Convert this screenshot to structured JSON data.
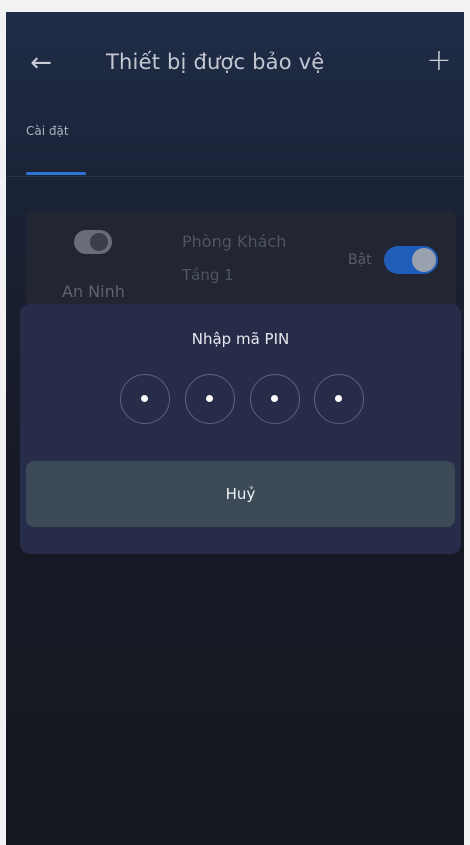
{
  "header": {
    "back_icon": "←",
    "title": "Thiết bị được bảo vệ",
    "add_icon": "+"
  },
  "tabs": [
    {
      "label": "Cài đặt",
      "active": true
    }
  ],
  "device_card": {
    "mode_label": "An Ninh",
    "mode_toggle_on": false,
    "room": "Phòng Khách",
    "floor": "Tầng 1",
    "state_label": "Bật",
    "state_toggle_on": true
  },
  "pin_dialog": {
    "title": "Nhập mã PIN",
    "digits_entered": 4,
    "cancel_label": "Huỷ"
  },
  "colors": {
    "accent": "#2c76d6",
    "dialog_bg": "#272c49",
    "cancel_bg": "#3b4a56"
  }
}
